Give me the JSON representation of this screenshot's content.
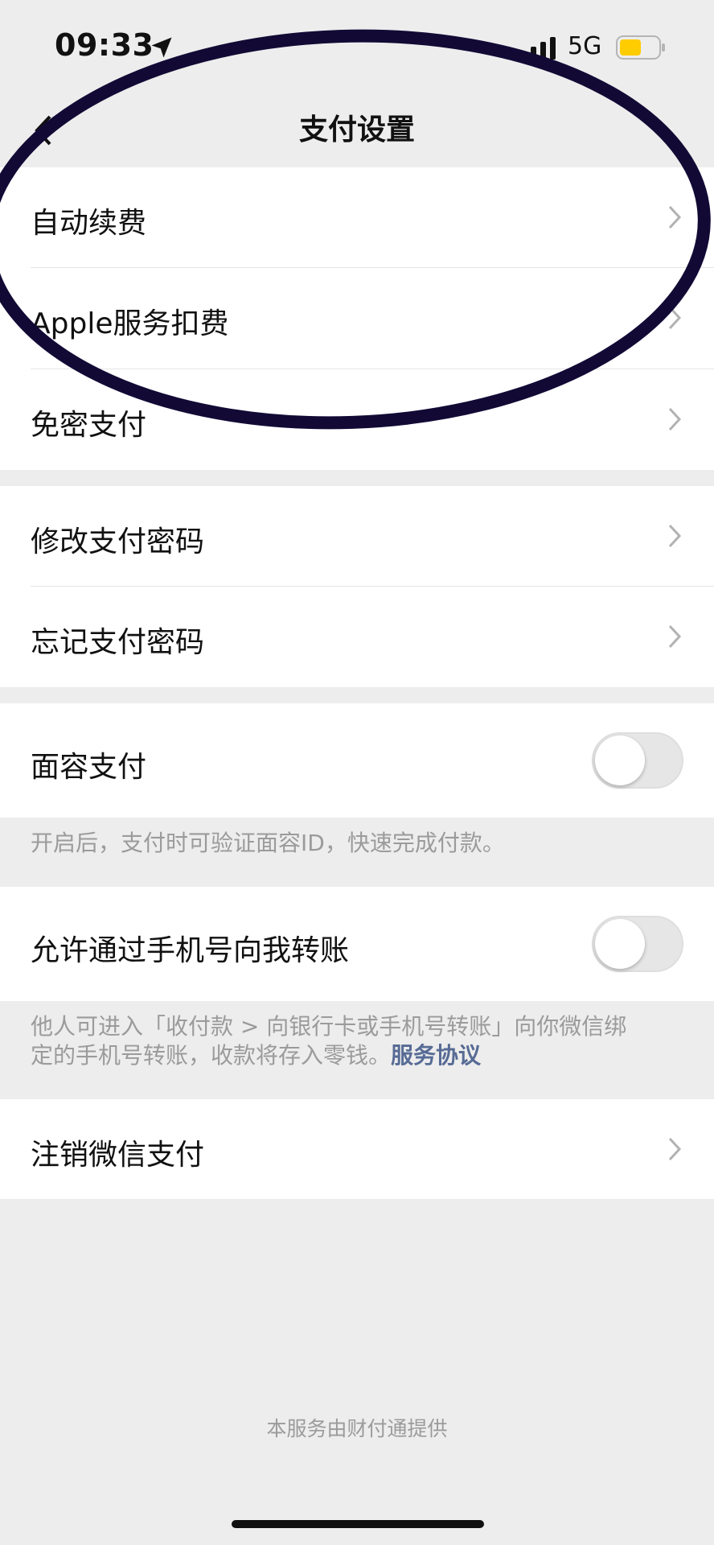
{
  "status_bar": {
    "time": "09:33",
    "network": "5G",
    "battery_color": "#ffcc00"
  },
  "nav": {
    "title": "支付设置"
  },
  "section1": {
    "items": [
      {
        "label": "自动续费"
      },
      {
        "label": "Apple服务扣费"
      },
      {
        "label": "免密支付"
      }
    ]
  },
  "section2": {
    "items": [
      {
        "label": "修改支付密码"
      },
      {
        "label": "忘记支付密码"
      }
    ]
  },
  "face_pay": {
    "label": "面容支付",
    "enabled": false,
    "note": "开启后，支付时可验证面容ID，快速完成付款。"
  },
  "phone_transfer": {
    "label": "允许通过手机号向我转账",
    "enabled": false,
    "note_line1": "他人可进入「收付款 > 向银行卡或手机号转账」向你微信绑",
    "note_line2": "定的手机号转账，收款将存入零钱。",
    "link": "服务协议"
  },
  "cancel": {
    "label": "注销微信支付"
  },
  "footer": {
    "text": "本服务由财付通提供"
  },
  "colors": {
    "background": "#ededed",
    "link": "#576b95",
    "annotation": "#120a35"
  }
}
